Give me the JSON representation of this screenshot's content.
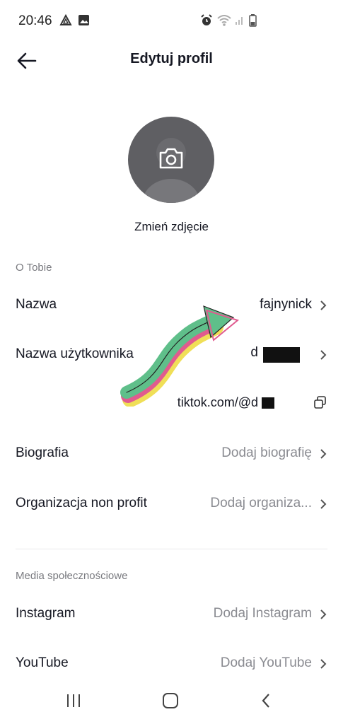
{
  "status": {
    "time": "20:46",
    "icons": [
      "drive-icon",
      "gallery-icon",
      "alarm-icon",
      "wifi-icon",
      "signal-icon",
      "battery-icon"
    ]
  },
  "header": {
    "title": "Edytuj profil",
    "back_icon": "arrow-left-icon"
  },
  "avatar": {
    "change_label": "Zmień zdjęcie",
    "icon": "camera-icon"
  },
  "about": {
    "section_label": "O Tobie",
    "rows": [
      {
        "label": "Nazwa",
        "value": "fajnynick"
      },
      {
        "label": "Nazwa użytkownika",
        "value": "d"
      },
      {
        "label": "Biografia",
        "value": "Dodaj biografię"
      },
      {
        "label": "Organizacja non profit",
        "value": "Dodaj organiza..."
      }
    ],
    "profile_link": "tiktok.com/@d"
  },
  "social": {
    "section_label": "Media społecznościowe",
    "rows": [
      {
        "label": "Instagram",
        "value": "Dodaj Instagram"
      },
      {
        "label": "YouTube",
        "value": "Dodaj YouTube"
      }
    ]
  },
  "navbar": {
    "icons": [
      "recent-apps-icon",
      "home-icon",
      "back-icon"
    ]
  },
  "colors": {
    "accent_arrow": "#5fbf8a",
    "text": "#161823",
    "muted": "#8a8b91"
  }
}
